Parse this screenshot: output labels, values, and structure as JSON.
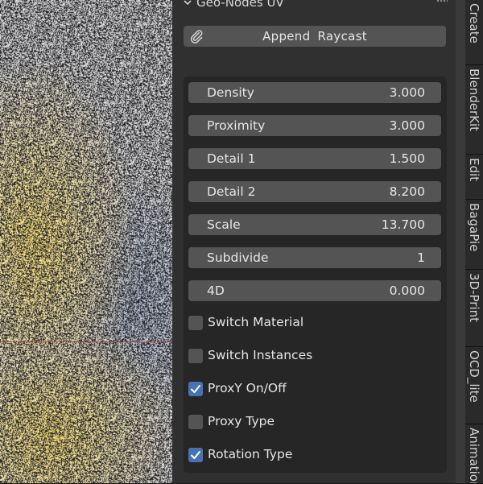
{
  "panel": {
    "title": "Geo-Nodes UV",
    "append_button": {
      "label": "Append  Raycast",
      "icon": "paperclip-icon"
    },
    "fields": [
      {
        "label": "Density",
        "value": "3.000"
      },
      {
        "label": "Proximity",
        "value": "3.000"
      },
      {
        "label": "Detail 1",
        "value": "1.500"
      },
      {
        "label": "Detail 2",
        "value": "8.200"
      },
      {
        "label": "Scale",
        "value": "13.700"
      },
      {
        "label": "Subdivide",
        "value": "1"
      },
      {
        "label": "4D",
        "value": "0.000"
      }
    ],
    "checkboxes": [
      {
        "label": "Switch Material",
        "checked": false
      },
      {
        "label": "Switch Instances",
        "checked": false
      },
      {
        "label": "ProxY On/Off",
        "checked": true
      },
      {
        "label": "Proxy Type",
        "checked": false
      },
      {
        "label": "Rotation Type",
        "checked": true
      }
    ]
  },
  "sidebar_tabs": [
    "Create",
    "BlenderKit",
    "Edit",
    "BagaPie",
    "3D-Print",
    "OCD_lite",
    "Animation"
  ],
  "colors": {
    "panel_bg": "#303030",
    "field_bg": "#545454",
    "checkbox_checked": "#4772b3"
  }
}
